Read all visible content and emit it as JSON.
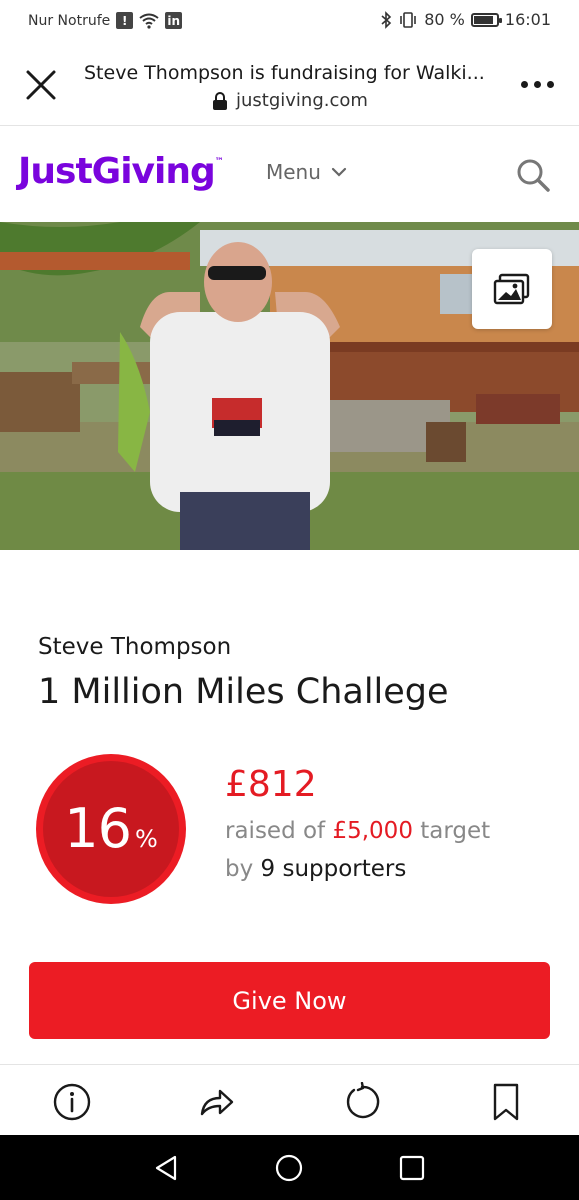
{
  "status_bar": {
    "carrier": "Nur Notrufe",
    "battery": "80 %",
    "time": "16:01"
  },
  "browser": {
    "title": "Steve Thompson is fundraising for Walki...",
    "url": "justgiving.com"
  },
  "site_header": {
    "logo": "JustGiving",
    "logo_tm": "™",
    "menu_label": "Menu"
  },
  "page": {
    "fundraiser_name": "Steve Thompson",
    "campaign_title": "1 Million Miles Challege",
    "progress_percent": "16",
    "progress_symbol": "%",
    "progress_fraction": 0.16,
    "raised_amount": "£812",
    "raised_prefix": "raised of ",
    "target_amount": "£5,000",
    "target_suffix": " target",
    "supporters_prefix": "by ",
    "supporters_count": "9 supporters",
    "give_button": "Give Now"
  },
  "icons": {
    "close": "close-icon",
    "lock": "lock-icon",
    "more": "more-icon",
    "chevron": "chevron-down-icon",
    "search": "search-icon",
    "gallery": "gallery-icon",
    "info": "info-icon",
    "share": "share-icon",
    "refresh": "refresh-icon",
    "bookmark": "bookmark-icon",
    "nav_back": "nav-back-icon",
    "nav_home": "nav-home-icon",
    "nav_recents": "nav-recents-icon"
  },
  "colors": {
    "brand_purple": "#7a04dd",
    "accent_red": "#ec1c24",
    "text_gray": "#888888"
  }
}
